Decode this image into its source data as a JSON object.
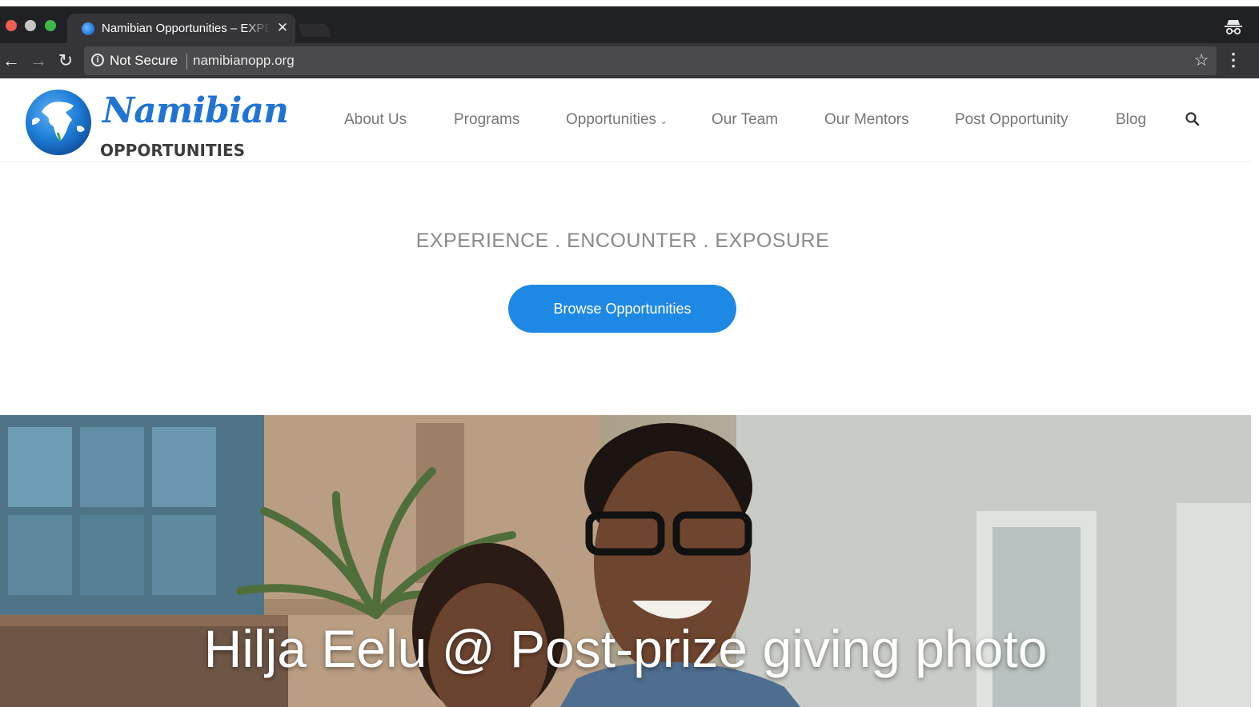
{
  "browser": {
    "tab_title": "Namibian Opportunities – EXPERIENCE . ENCOUNTER . EXPOSURE",
    "tab_close": "✕",
    "security_label": "Not Secure",
    "url": "namibianopp.org"
  },
  "logo": {
    "script_text": "Namibian",
    "sub_text": "OPPORTUNITIES"
  },
  "nav": {
    "items": [
      {
        "label": "About Us"
      },
      {
        "label": "Programs"
      },
      {
        "label": "Opportunities"
      },
      {
        "label": "Our Team"
      },
      {
        "label": "Our Mentors"
      },
      {
        "label": "Post Opportunity"
      },
      {
        "label": "Blog"
      }
    ],
    "dropdown_caret": "⌄"
  },
  "hero": {
    "tagline": "EXPERIENCE . ENCOUNTER . EXPOSURE",
    "cta_label": "Browse Opportunities"
  },
  "banner": {
    "caption": "Hilja Eelu @ Post-prize giving photo"
  },
  "colors": {
    "accent": "#1e88e5",
    "logo_blue": "#1f74d4",
    "chrome_dark": "#202124",
    "nav_text": "#777777"
  },
  "icons": {
    "favicon": "globe-icon",
    "back": "arrow-left-icon",
    "forward": "arrow-right-icon",
    "reload": "reload-icon",
    "info": "info-icon",
    "bookmark": "star-icon",
    "menu": "kebab-menu-icon",
    "incognito": "incognito-icon",
    "search": "search-icon"
  }
}
